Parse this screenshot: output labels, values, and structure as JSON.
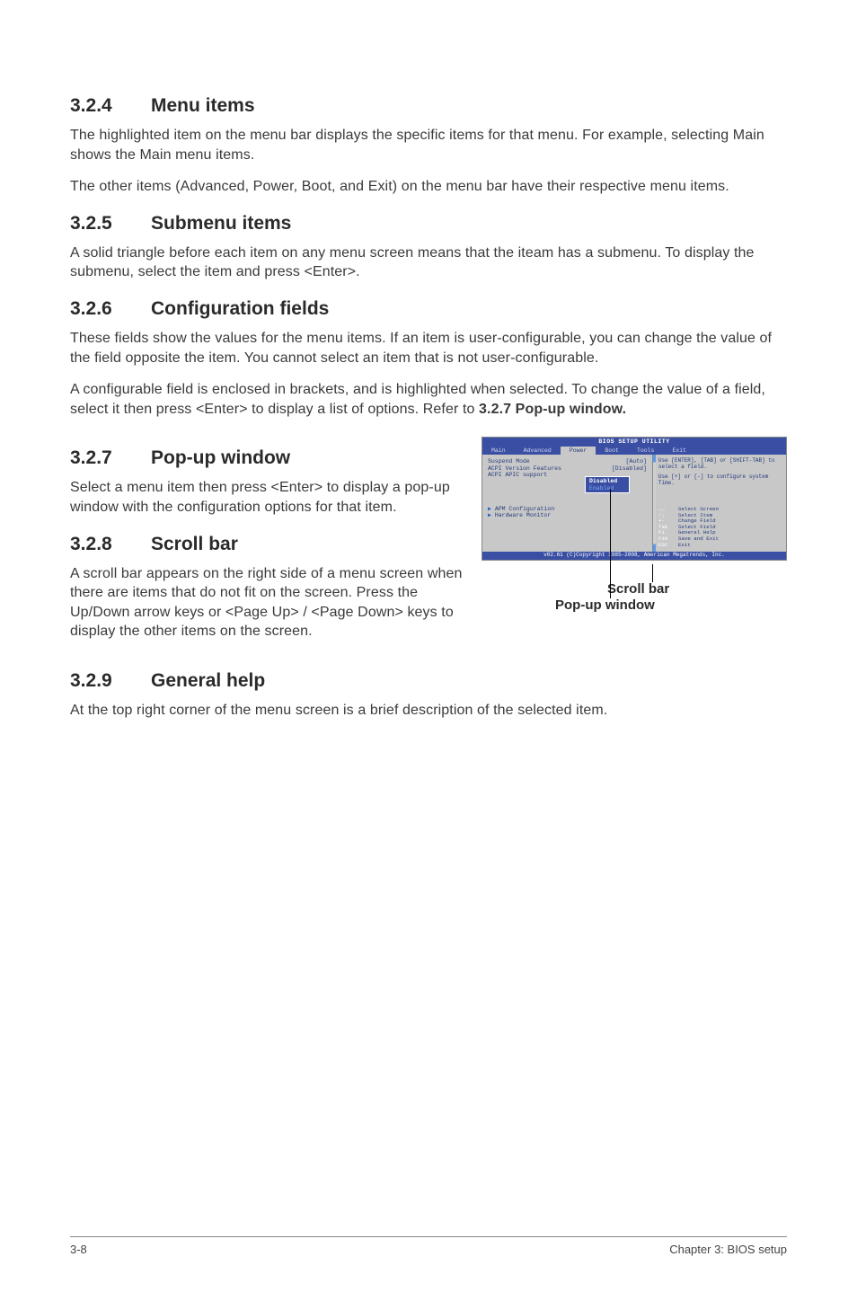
{
  "s324": {
    "num": "3.2.4",
    "title": "Menu items",
    "p1": "The highlighted item on the menu bar displays the specific items for that menu. For example, selecting Main shows the Main menu items.",
    "p2": "The other items (Advanced, Power, Boot, and Exit) on the menu bar have their respective menu items."
  },
  "s325": {
    "num": "3.2.5",
    "title": "Submenu items",
    "p1": "A solid triangle before each item on any menu screen means that the iteam has a submenu. To display the submenu, select the item and press <Enter>."
  },
  "s326": {
    "num": "3.2.6",
    "title": "Configuration fields",
    "p1": "These fields show the values for the menu items. If an item is user-configurable, you can change the value of the field opposite the item. You cannot select an item that is not user-configurable.",
    "p2a": "A configurable field is enclosed in brackets, and is highlighted when selected. To change the value of a field, select it then press <Enter> to display a list of options. Refer to ",
    "p2b": "3.2.7 Pop-up window."
  },
  "s327": {
    "num": "3.2.7",
    "title": "Pop-up window",
    "p1": "Select a menu item then press <Enter> to display a pop-up window with the configuration options for that item."
  },
  "s328": {
    "num": "3.2.8",
    "title": "Scroll bar",
    "p1": "A scroll bar appears on the right side of a menu screen when there are items that do not fit on the screen. Press the Up/Down arrow keys or <Page Up> / <Page Down> keys to display the other items on the screen."
  },
  "s329": {
    "num": "3.2.9",
    "title": "General help",
    "p1": "At the top right corner of the menu screen is a brief description of the selected item."
  },
  "bios": {
    "title": "BIOS SETUP UTILITY",
    "menu": {
      "main": "Main",
      "advanced": "Advanced",
      "power": "Power",
      "boot": "Boot",
      "tools": "Tools",
      "exit": "Exit"
    },
    "rows": {
      "r1l": "Suspend Mode",
      "r1v": "[Auto]",
      "r2l": "ACPI Version Features",
      "r2v": "[Disabled]",
      "r3l": "ACPI APIC support",
      "pop1": "Disabled",
      "pop2": "Enabled",
      "sub1": "APM Configuration",
      "sub2": "Hardware Monitor"
    },
    "help": {
      "h1": "Use [ENTER], [TAB] or [SHIFT-TAB] to select a field.",
      "h2": "Use [+] or [-] to configure system Time.",
      "k1l": "←→",
      "k1r": "Select Screen",
      "k2l": "↑↓",
      "k2r": "Select Item",
      "k3l": "+-",
      "k3r": "Change Field",
      "k4l": "Tab",
      "k4r": "Select Field",
      "k5l": "F1",
      "k5r": "General Help",
      "k6l": "F10",
      "k6r": "Save and Exit",
      "k7l": "ESC",
      "k7r": "Exit"
    },
    "foot": "v02.61 (C)Copyright 1985-2008, American Megatrends, Inc."
  },
  "callouts": {
    "scroll": "Scroll bar",
    "popup": "Pop-up window"
  },
  "footer": {
    "left": "3-8",
    "right": "Chapter 3: BIOS setup"
  }
}
